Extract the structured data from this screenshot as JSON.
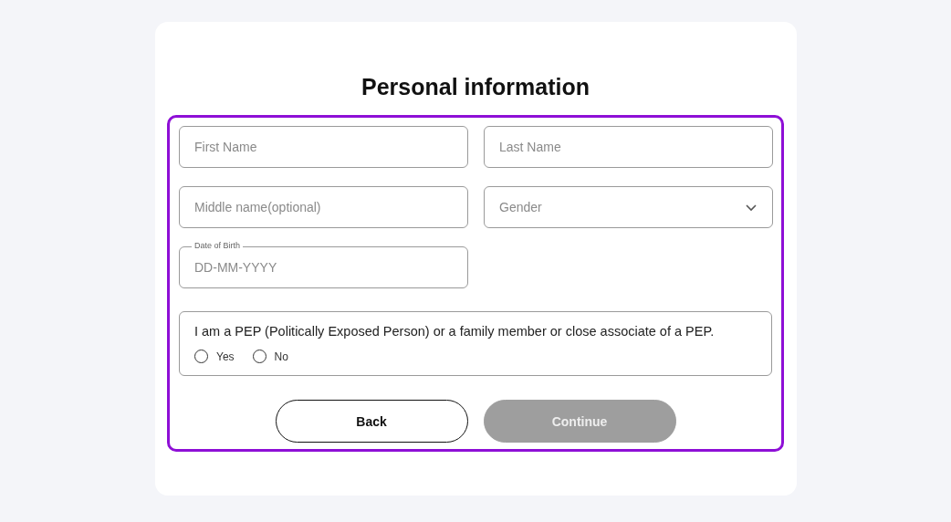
{
  "title": "Personal information",
  "fields": [
    {
      "kind": "text",
      "placeholder": "First Name"
    },
    {
      "kind": "text",
      "placeholder": "Last Name"
    },
    {
      "kind": "text",
      "placeholder": "Middle name(optional)"
    },
    {
      "kind": "select",
      "placeholder": "Gender"
    },
    {
      "kind": "date",
      "label": "Date of Birth",
      "placeholder": "DD-MM-YYYY"
    }
  ],
  "pep": {
    "question": "I am a PEP (Politically Exposed Person) or a family member or close associate of a PEP.",
    "options": [
      {
        "label": "Yes",
        "selected": false
      },
      {
        "label": "No",
        "selected": false
      }
    ]
  },
  "buttons": [
    {
      "label": "Back",
      "disabled": false
    },
    {
      "label": "Continue",
      "disabled": true
    }
  ]
}
